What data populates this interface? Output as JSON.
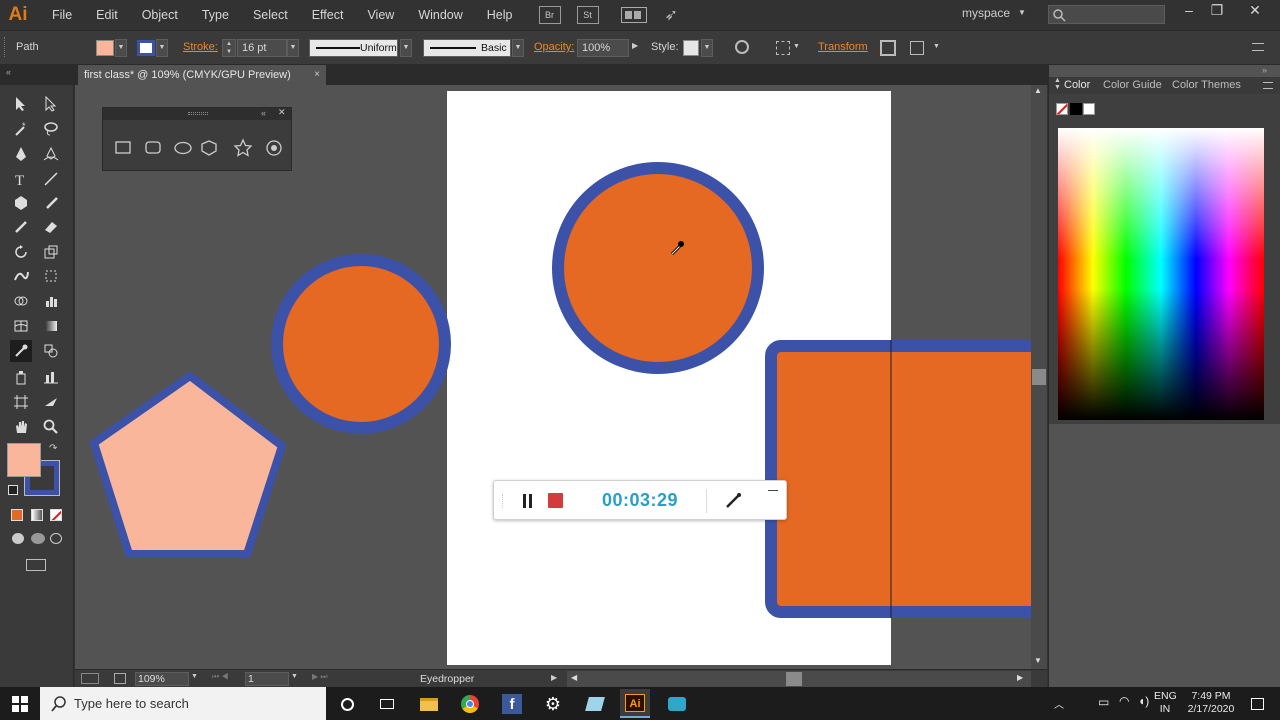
{
  "app": {
    "logo": "Ai",
    "menu": [
      "File",
      "Edit",
      "Object",
      "Type",
      "Select",
      "Effect",
      "View",
      "Window",
      "Help"
    ],
    "bridge_label": "Br",
    "stock_label": "St",
    "workspace": "myspace"
  },
  "control_bar": {
    "selection": "Path",
    "stroke_label": "Stroke:",
    "stroke_weight": "16 pt",
    "profile": "Uniform",
    "brush": "Basic",
    "opacity_label": "Opacity:",
    "opacity": "100%",
    "style_label": "Style:",
    "transform_label": "Transform"
  },
  "document": {
    "tab_title": "first class* @ 109% (CMYK/GPU Preview)",
    "close": "×"
  },
  "recorder": {
    "time": "00:03:29"
  },
  "status": {
    "zoom": "109%",
    "artboard": "1",
    "tool": "Eyedropper"
  },
  "panel": {
    "tabs": [
      "Color",
      "Color Guide",
      "Color Themes"
    ]
  },
  "taskbar": {
    "search_placeholder": "Type here to search",
    "lang_top": "ENG",
    "lang_bottom": "IN",
    "time": "7:49 PM",
    "date": "2/17/2020"
  },
  "colors": {
    "fill_swatch": "#f9b69a",
    "stroke_blue": "#3b52a8",
    "orange": "#e56823",
    "pentagon_fill": "#f9b69a",
    "accent_orange": "#e8872e"
  }
}
